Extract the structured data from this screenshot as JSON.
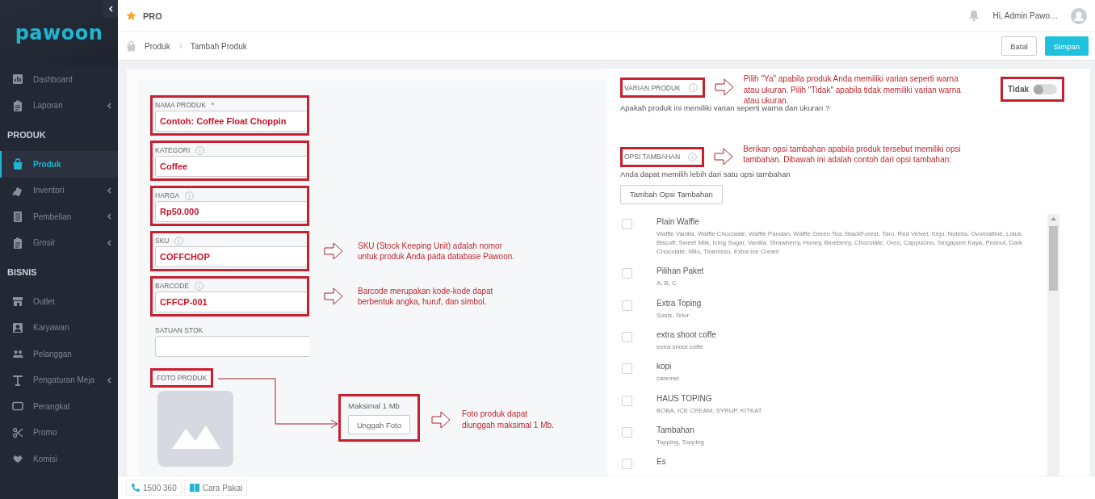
{
  "sidebar": {
    "logo": "pawoon",
    "sections": [
      {
        "items": [
          {
            "label": "Dashboard",
            "expandable": false,
            "selected": false
          },
          {
            "label": "Laporan",
            "expandable": true,
            "selected": false
          }
        ]
      },
      {
        "title": "PRODUK",
        "items": [
          {
            "label": "Produk",
            "expandable": false,
            "selected": true
          },
          {
            "label": "Inventori",
            "expandable": true,
            "selected": false
          },
          {
            "label": "Pembelian",
            "expandable": true,
            "selected": false
          },
          {
            "label": "Grosir",
            "expandable": true,
            "selected": false
          }
        ]
      },
      {
        "title": "BISNIS",
        "items": [
          {
            "label": "Outlet",
            "expandable": false,
            "selected": false
          },
          {
            "label": "Karyawan",
            "expandable": false,
            "selected": false
          },
          {
            "label": "Pelanggan",
            "expandable": false,
            "selected": false
          },
          {
            "label": "Pengaturan Meja",
            "expandable": true,
            "selected": false
          },
          {
            "label": "Perangkat",
            "expandable": false,
            "selected": false
          },
          {
            "label": "Promo",
            "expandable": false,
            "selected": false
          },
          {
            "label": "Komisi",
            "expandable": false,
            "selected": false
          }
        ]
      }
    ]
  },
  "topbar": {
    "badge": "PRO",
    "greeting": "Hi, Admin Pawo…"
  },
  "breadcrumb": [
    "Produk",
    "Tambah Produk"
  ],
  "actions": [
    {
      "label": "Batal",
      "kind": "secondary"
    },
    {
      "label": "Simpan",
      "kind": "primary"
    }
  ],
  "form": {
    "fields": [
      {
        "label": "NAMA PRODUK",
        "required_mark": "*",
        "info": false,
        "value": "Contoh: Coffee Float Choppin",
        "highlighted": true
      },
      {
        "label": "KATEGORI",
        "info": true,
        "value": "Coffee",
        "highlighted": true
      },
      {
        "label": "HARGA",
        "info": true,
        "value": "Rp50.000",
        "highlighted": true
      },
      {
        "label": "SKU",
        "info": true,
        "value": "COFFCHOP",
        "highlighted": true,
        "note": "SKU (Stock Keeping Unit) adalah nomor\nuntuk produk Anda pada database Pawoon."
      },
      {
        "label": "BARCODE",
        "info": true,
        "value": "CFFCP-001",
        "highlighted": true,
        "note": "Barcode merupakan kode-kode dapat\nberbentuk angka, huruf, dan simbol."
      },
      {
        "label": "SATUAN STOK",
        "info": false,
        "highlighted": false
      }
    ],
    "photo": {
      "label": "FOTO PRODUK",
      "highlighted": true,
      "limit": "Maksimal 1 Mb",
      "button": "Unggah Foto",
      "upload_highlighted": true,
      "note": "Foto produk dapat\ndiunggah maksimal 1 Mb."
    }
  },
  "variants": {
    "label": "VARIAN PRODUK",
    "highlighted": true,
    "note": "Pilih \"Ya\" apabila produk Anda memiliki varian seperti warna\natau  ukuran. Pilih \"Tidak\" apabila tidak memiliki varian warna\natau ukuran.",
    "question": "Apakah produk ini memiliki varian seperti warna dan ukuran ?",
    "toggle": {
      "label": "Tidak",
      "on": false,
      "highlighted": true
    }
  },
  "extras": {
    "label": "OPSI TAMBAHAN",
    "highlighted": true,
    "note": "Berikan opsi tambahan apabila produk tersebut memiliki opsi\ntambahan. Dibawah ini adalah contoh dari opsi tambahan:",
    "hint": "Anda dapat memilih lebih dari satu opsi tambahan",
    "button": "Tambah Opsi Tambahan",
    "options": [
      {
        "name": "Plain Waffle",
        "items": "Waffle Vanilla, Waffle Chocolate, Waffle Pandan, Waffle Green Tea, BlackForest, Taro, Red Velvet, Keju, Nutella, Ovomaltine, Lotus Biscoff, Sweet Milk, Icing Sugar, Vanilla, Strawberry, Honey, Blueberry, Chocolate, Oreo, Cappucino, Singapore Kaya, Peanut, Dark Chocolate, Milo, Tiramissu, Extra Ice Cream",
        "checked": false
      },
      {
        "name": "Pilihan Paket",
        "items": "A, B, C",
        "checked": false
      },
      {
        "name": "Extra Toping",
        "items": "Sosis, Telur",
        "checked": false
      },
      {
        "name": "extra shoot coffe",
        "items": "extra shoot coffe",
        "checked": false
      },
      {
        "name": "kopi",
        "items": "caremel",
        "checked": false
      },
      {
        "name": "HAUS TOPING",
        "items": "BOBA, ICE CREAM, SYRUP, KITKAT",
        "checked": false
      },
      {
        "name": "Tambahan",
        "items": "Topping, Topping",
        "checked": false
      },
      {
        "name": "Es",
        "checked": false
      }
    ]
  },
  "footer": [
    {
      "label": "1500 360"
    },
    {
      "label": "Cara Pakai"
    }
  ]
}
